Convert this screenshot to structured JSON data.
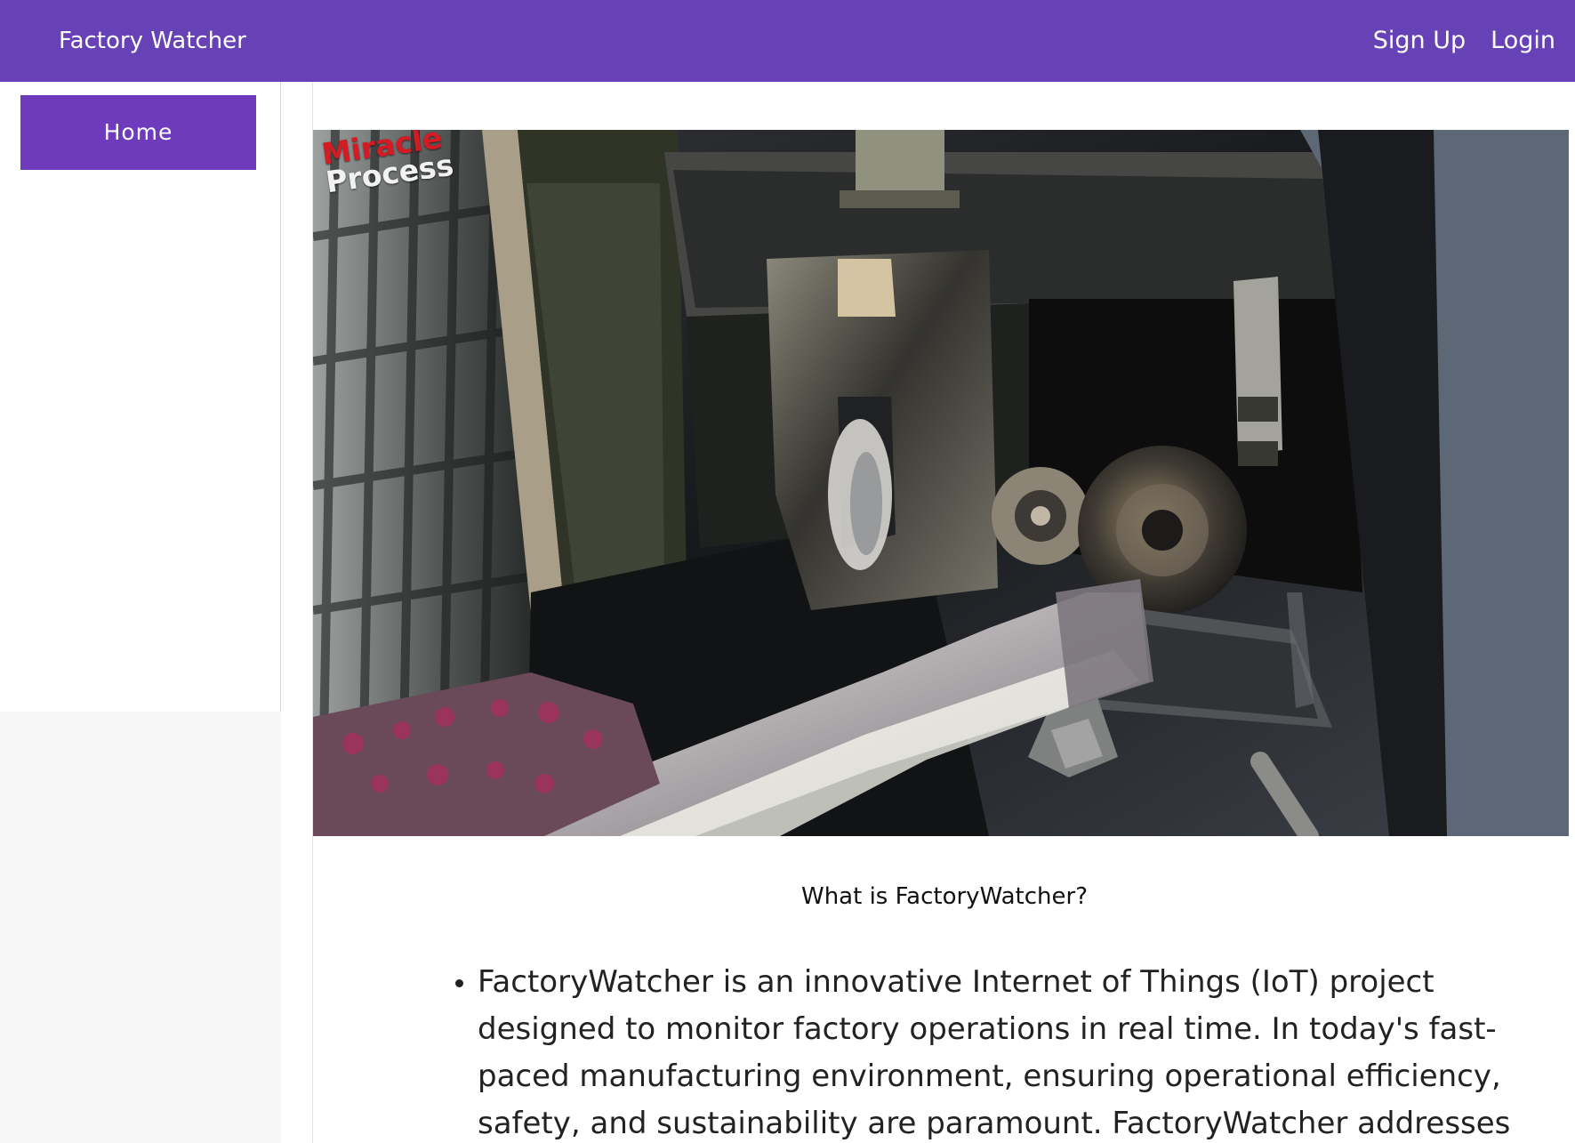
{
  "header": {
    "brand": "Factory Watcher",
    "actions": {
      "sign_up": "Sign Up",
      "login": "Login"
    }
  },
  "sidebar": {
    "items": [
      {
        "label": "Home"
      }
    ]
  },
  "main": {
    "hero_watermark": {
      "line1": "Miracle",
      "line2": "Process"
    },
    "section_title": "What is FactoryWatcher?",
    "bullets": [
      "FactoryWatcher is an innovative Internet of Things (IoT) project designed to monitor factory operations in real time. In today's fast-paced manufacturing environment, ensuring operational efficiency, safety, and sustainability are paramount. FactoryWatcher addresses these concerns by leveraging IoT"
    ]
  },
  "colors": {
    "header_bg": "#6742b6",
    "sidebar_active_bg": "#6d3bbb",
    "text": "#222222",
    "watermark_red": "#d61a24"
  }
}
